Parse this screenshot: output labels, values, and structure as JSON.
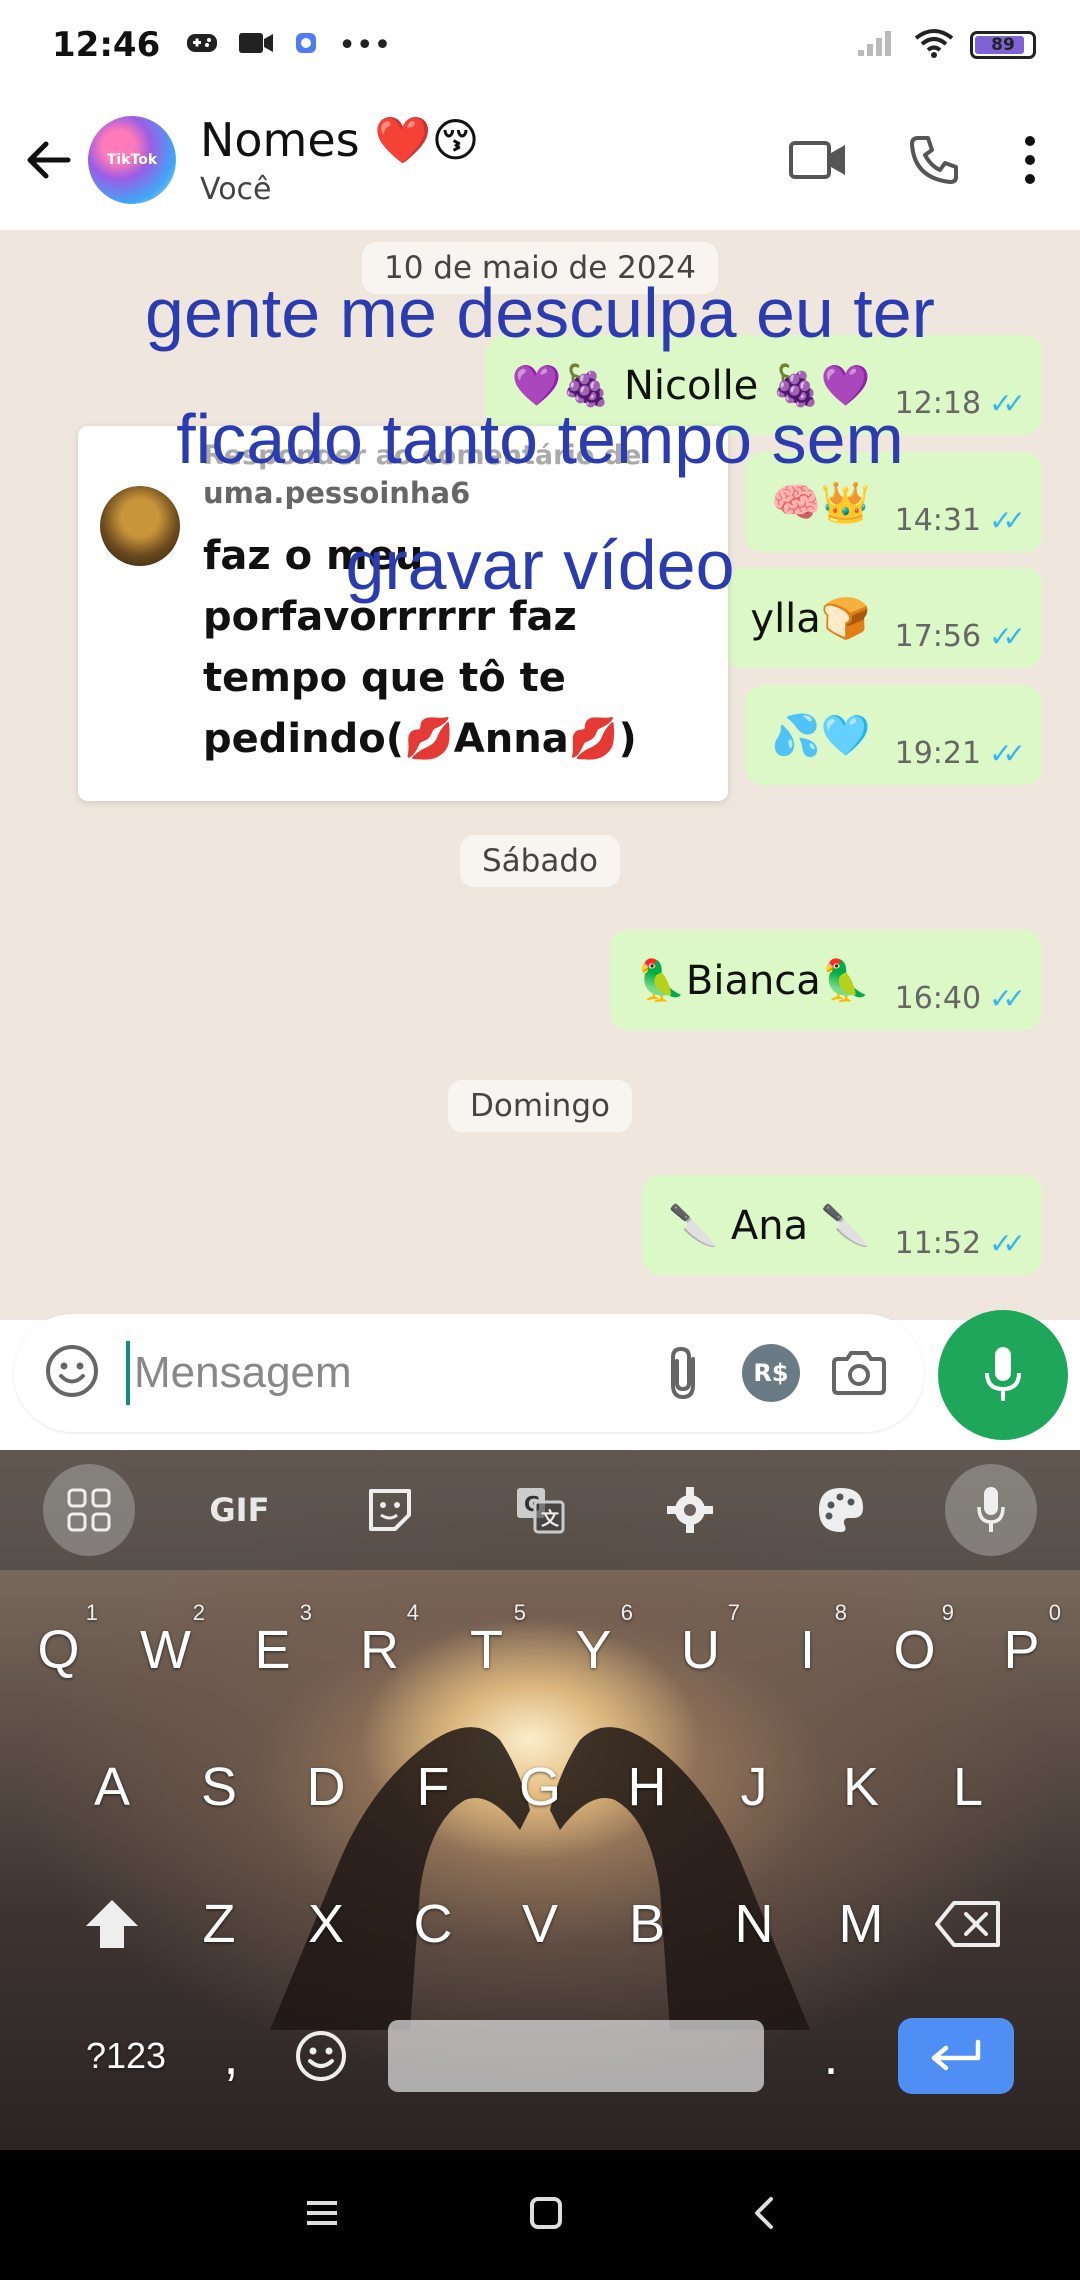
{
  "status_bar": {
    "time": "12:46",
    "icons": [
      "gamepad-icon",
      "video-camera-icon",
      "app-icon",
      "more-dots-icon"
    ],
    "more": "•••",
    "battery_level": "89",
    "battery_fraction": 0.89,
    "battery_color": "#7d63d6"
  },
  "header": {
    "title": "Nomes ❤️😚",
    "subtitle": "Você",
    "avatar_label": "TikTok"
  },
  "chat": {
    "background_color": "#efe7dd",
    "bubble_color": "#dcf8c6",
    "date_separators": [
      "10 de maio de 2024",
      "Sábado",
      "Domingo"
    ],
    "messages": [
      {
        "text": "💜🍇 Nicolle 🍇💜",
        "time": "12:18"
      },
      {
        "text": "🧠👑",
        "time": "14:31"
      },
      {
        "text": "ylla🍞",
        "time": "17:56"
      },
      {
        "text": "💦🩵",
        "time": "19:21"
      },
      {
        "text": "🦜Bianca🦜",
        "time": "16:40"
      },
      {
        "text": "🔪 Ana 🔪",
        "time": "11:52"
      }
    ],
    "ticks": "✓✓",
    "tick_color": "#34b7f1"
  },
  "tiktok_reply": {
    "heading": "Responder ao comentário de",
    "username": "uma.pessoinha6",
    "comment": "faz o meu\nporfavorrrrrr faz\ntempo que tô te\npedindo(💋Anna💋)"
  },
  "overlay_caption": "gente me desculpa eu ter\nficado tanto tempo sem\ngravar vídeo",
  "input": {
    "placeholder": "Mensagem",
    "currency_label": "R$"
  },
  "keyboard": {
    "toolbar": [
      "apps-icon",
      "GIF",
      "sticker-icon",
      "translate-icon",
      "gear-icon",
      "palette-icon",
      "mic-icon"
    ],
    "gif_label": "GIF",
    "row1": [
      [
        "Q",
        "1"
      ],
      [
        "W",
        "2"
      ],
      [
        "E",
        "3"
      ],
      [
        "R",
        "4"
      ],
      [
        "T",
        "5"
      ],
      [
        "Y",
        "6"
      ],
      [
        "U",
        "7"
      ],
      [
        "I",
        "8"
      ],
      [
        "O",
        "9"
      ],
      [
        "P",
        "0"
      ]
    ],
    "row2": [
      "A",
      "S",
      "D",
      "F",
      "G",
      "H",
      "J",
      "K",
      "L"
    ],
    "row3": [
      "Z",
      "X",
      "C",
      "V",
      "B",
      "N",
      "M"
    ],
    "bottom": {
      "symbols": "?123",
      "comma": ",",
      "period": "."
    },
    "enter_color": "#4f8ef5"
  }
}
